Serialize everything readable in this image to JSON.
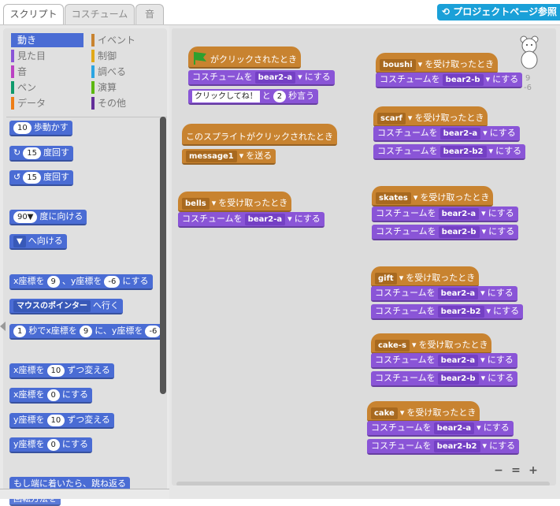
{
  "tabs": {
    "script": "スクリプト",
    "costume": "コスチューム",
    "sound": "音"
  },
  "project_button": "プロジェクトページ参照",
  "categories": [
    {
      "label": "動き",
      "color": "#4a6cd4",
      "selected": true
    },
    {
      "label": "見た目",
      "color": "#8a55d7",
      "selected": false
    },
    {
      "label": "音",
      "color": "#bb42c3",
      "selected": false
    },
    {
      "label": "ペン",
      "color": "#0e9a6c",
      "selected": false
    },
    {
      "label": "データ",
      "color": "#ee7d16",
      "selected": false
    },
    {
      "label": "イベント",
      "color": "#c88330",
      "selected": false
    },
    {
      "label": "制御",
      "color": "#e1a91a",
      "selected": false
    },
    {
      "label": "調べる",
      "color": "#2ca5e2",
      "selected": false
    },
    {
      "label": "演算",
      "color": "#5cb712",
      "selected": false
    },
    {
      "label": "その他",
      "color": "#632d99",
      "selected": false
    }
  ],
  "palette": {
    "move": {
      "n": "10",
      "t": "歩動かす"
    },
    "turn_right": {
      "n": "15",
      "t": "度回す"
    },
    "turn_left": {
      "n": "15",
      "t": "度回す"
    },
    "point_dir": {
      "n": "90▼",
      "t": "度に向ける"
    },
    "point_toward": {
      "t": "へ向ける"
    },
    "goto_xy": {
      "a": "x座標を",
      "x": "9",
      "b": "、y座標を",
      "y": "-6",
      "c": "にする"
    },
    "goto": {
      "v": "マウスのポインター",
      "t": "へ行く"
    },
    "glide": {
      "s": "1",
      "a": "秒でx座標を",
      "x": "9",
      "b": "に、y座標を",
      "y": "-6"
    },
    "change_x": {
      "a": "x座標を",
      "n": "10",
      "b": "ずつ変える"
    },
    "set_x": {
      "a": "x座標を",
      "n": "0",
      "b": "にする"
    },
    "change_y": {
      "a": "y座標を",
      "n": "10",
      "b": "ずつ変える"
    },
    "set_y": {
      "a": "y座標を",
      "n": "0",
      "b": "にする"
    },
    "bounce": "もし端に着いたら、跳ね返る",
    "rotation": "回転方法を"
  },
  "scripts": {
    "costume_label": "コスチュームを",
    "set_label": "にする",
    "receive_label": "を受け取ったとき",
    "flag_hat": "がクリックされたとき",
    "say_text": "クリックしてね！",
    "say_and": "と",
    "say_secs": "2",
    "say_end": "秒言う",
    "sprite_hat": "このスプライトがクリックされたとき",
    "broadcast_msg": "message1",
    "broadcast_label": "を送る",
    "flag_costume": "bear2-a",
    "bells_msg": "bells",
    "bells_costume": "bear2-a",
    "boushi_msg": "boushi",
    "boushi_costume": "bear2-b",
    "scarf_msg": "scarf",
    "scarf_c1": "bear2-a",
    "scarf_c2": "bear2-b2",
    "skates_msg": "skates",
    "skates_c1": "bear2-a",
    "skates_c2": "bear2-b",
    "gift_msg": "gift",
    "gift_c1": "bear2-a",
    "gift_c2": "bear2-b2",
    "cakes_msg": "cake-s",
    "cakes_c1": "bear2-a",
    "cakes_c2": "bear2-b",
    "cake_msg": "cake",
    "cake_c1": "bear2-a",
    "cake_c2": "bear2-b2"
  },
  "sprite_info": {
    "x": "9",
    "y": "-6"
  }
}
